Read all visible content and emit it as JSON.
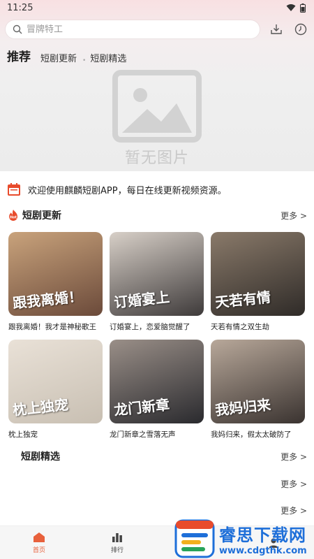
{
  "status_bar": {
    "time": "11:25"
  },
  "search": {
    "placeholder": "冒牌特工"
  },
  "tabs": [
    {
      "label": "推荐",
      "active": true
    },
    {
      "label": "短剧更新",
      "active": false
    },
    {
      "label": "短剧精选",
      "active": false
    }
  ],
  "banner": {
    "placeholder_text": "暂无图片"
  },
  "notice": {
    "text": "欢迎使用麒麟短剧APP，每日在线更新视频资源。"
  },
  "sections": {
    "updates": {
      "badge": "Hot",
      "title": "短剧更新",
      "more": "更多 >"
    },
    "featured": {
      "title": "短剧精选",
      "more": "更多 >"
    },
    "more_2": "更多 >",
    "more_3": "更多 >"
  },
  "dramas": [
    {
      "name": "跟我离婚！我才是神秘歌王",
      "poster_title": "跟我离婚！",
      "color_a": "#6b4a3a",
      "color_b": "#c9a37c"
    },
    {
      "name": "订婚宴上，恋爱脑觉醒了",
      "poster_title": "订婚宴上",
      "color_a": "#3e3a3a",
      "color_b": "#d8d0c8"
    },
    {
      "name": "天若有情之双生劫",
      "poster_title": "天若有情",
      "color_a": "#2f2b28",
      "color_b": "#8a7a6a"
    },
    {
      "name": "枕上独宠",
      "poster_title": "枕上独宠",
      "color_a": "#c8bfb2",
      "color_b": "#e9e1d7"
    },
    {
      "name": "龙门新章之雪落无声",
      "poster_title": "龙门新章",
      "color_a": "#2a2a2e",
      "color_b": "#9a8f88"
    },
    {
      "name": "我妈归来，假太太破防了",
      "poster_title": "我妈归来",
      "color_a": "#3a3330",
      "color_b": "#b8a89a"
    }
  ],
  "bottom_nav": [
    {
      "label": "首页",
      "icon": "home-icon",
      "active": true
    },
    {
      "label": "排行",
      "icon": "ranking-icon",
      "active": false
    },
    {
      "label": "",
      "icon": "category-icon",
      "active": false
    },
    {
      "label": "",
      "icon": "profile-icon",
      "active": false
    }
  ],
  "watermark": {
    "brand": "睿思下载网",
    "url": "www.cdgthk.com"
  },
  "colors": {
    "accent": "#e8613c",
    "hot_badge": "#e84b2c",
    "watermark_blue": "#1e6fd9"
  }
}
